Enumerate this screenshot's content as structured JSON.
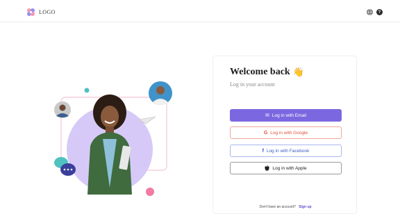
{
  "header": {
    "logo_text": "LOGO",
    "globe_icon": "globe-icon",
    "help_icon": "help-icon",
    "help_glyph": "?"
  },
  "login": {
    "title": "Welcome back",
    "title_emoji": "👋",
    "subtitle": "Log in your account",
    "buttons": [
      {
        "label": "Log in with Email",
        "icon": "mail-icon",
        "glyph": "✉"
      },
      {
        "label": "Log in with Google",
        "icon": "google-icon",
        "glyph": "G"
      },
      {
        "label": "Log in with Facebook",
        "icon": "facebook-icon",
        "glyph": "f"
      },
      {
        "label": "Log in with Apple",
        "icon": "apple-icon",
        "glyph": ""
      }
    ],
    "signup_prompt": "Don't have an account?",
    "signup_link": "Sign up"
  },
  "colors": {
    "primary": "#7b68e0",
    "google": "#e0523c",
    "facebook": "#3b5cc8",
    "illustration_circle": "#d7c9f7",
    "accent_pink": "#f27aa3",
    "accent_teal": "#4fc1c1"
  }
}
